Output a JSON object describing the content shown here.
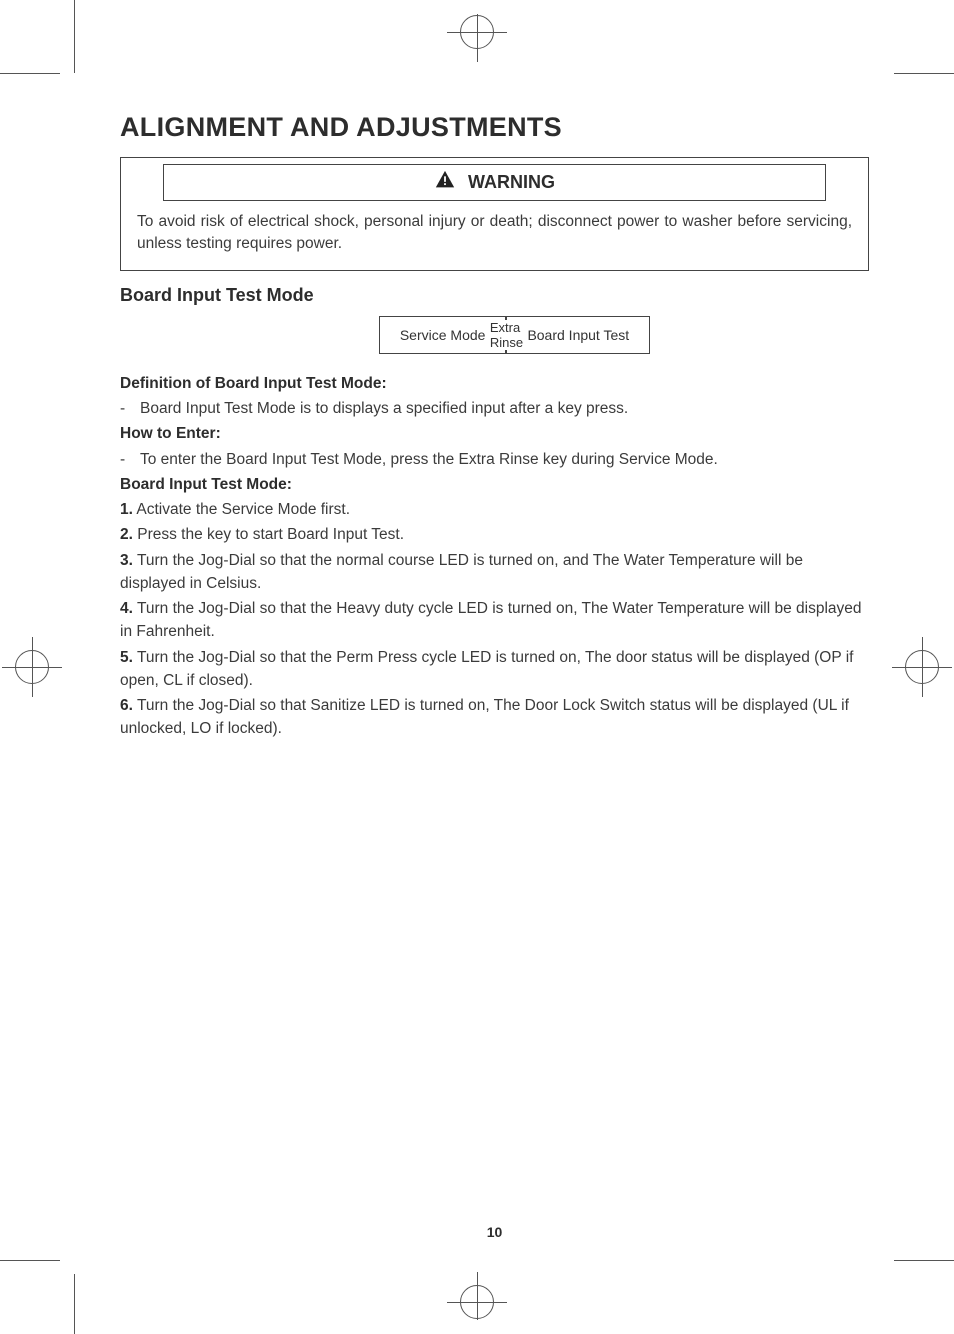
{
  "title": "ALIGNMENT AND ADJUSTMENTS",
  "warning": {
    "label": "WARNING",
    "text": "To avoid risk of electrical shock, personal injury or death; disconnect power to washer before servicing, unless testing requires power."
  },
  "section_heading": "Board Input Test Mode",
  "diagram": {
    "left_box": "Service Mode",
    "arrow_label": "Extra Rinse",
    "right_box": "Board Input Test"
  },
  "definition": {
    "heading": "Definition of Board Input Test Mode:",
    "item": "Board Input Test Mode is to displays a specified input after a key press."
  },
  "how_to_enter": {
    "heading": "How to Enter:",
    "item": "To enter the Board Input Test Mode, press the Extra Rinse key during Service Mode."
  },
  "steps": {
    "heading": "Board Input Test Mode:",
    "items": [
      {
        "num": "1.",
        "text": "Activate the Service Mode first."
      },
      {
        "num": "2.",
        "text": "Press the key to start Board Input Test."
      },
      {
        "num": "3.",
        "text": "Turn the Jog-Dial so that the normal course LED is turned on, and The Water Temperature will be displayed in Celsius."
      },
      {
        "num": "4.",
        "text": "Turn the Jog-Dial so that the Heavy duty cycle LED is turned on, The Water Temperature will be displayed in Fahrenheit."
      },
      {
        "num": "5.",
        "text": "Turn the Jog-Dial so that the Perm Press cycle LED is turned on, The door status will be displayed (OP if open, CL if closed)."
      },
      {
        "num": "6.",
        "text": "Turn the Jog-Dial so that Sanitize LED is turned on, The Door Lock Switch status will be displayed (UL if unlocked, LO if locked)."
      }
    ]
  },
  "page_number": "10"
}
